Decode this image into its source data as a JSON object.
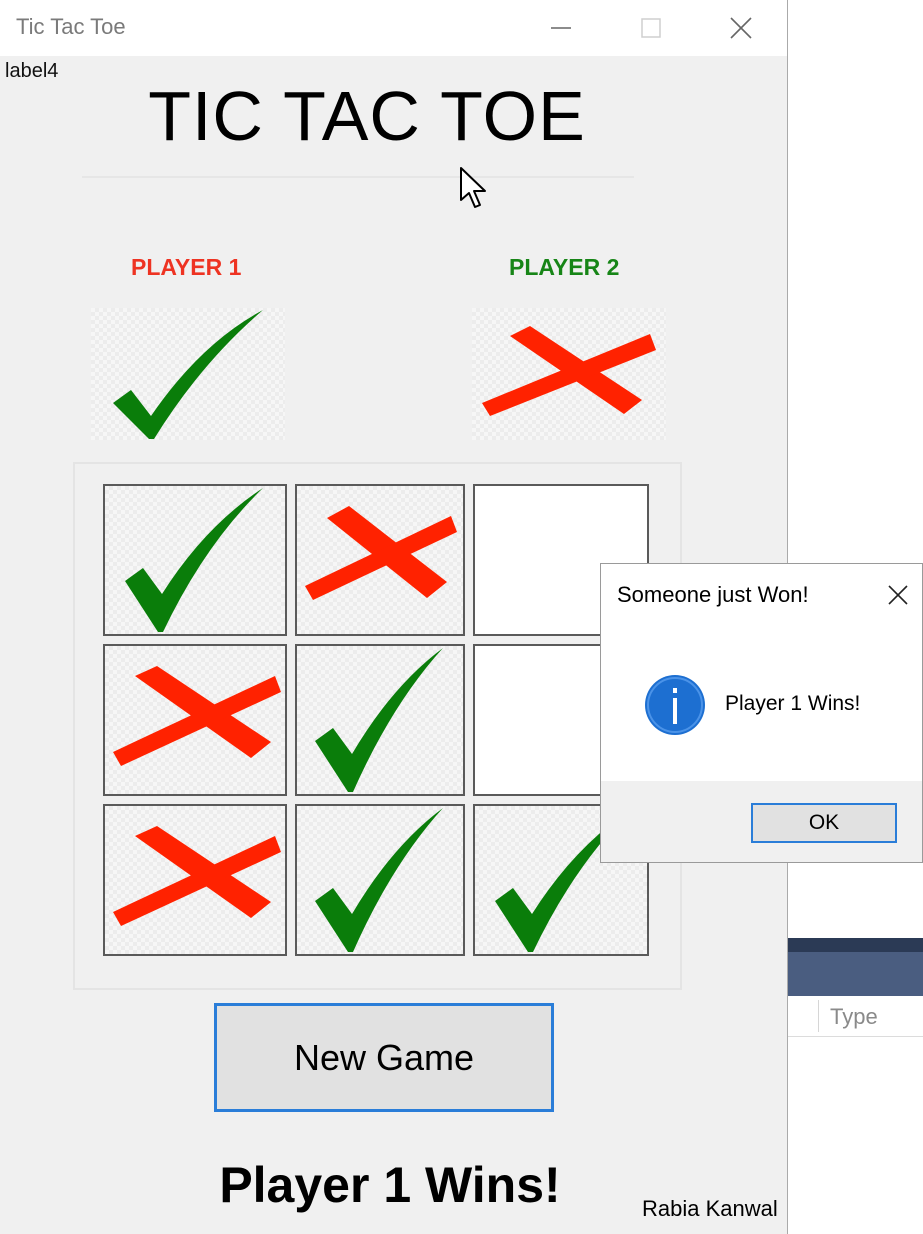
{
  "window": {
    "title": "Tic Tac Toe",
    "label_text": "label4",
    "game_title": "TIC TAC TOE",
    "caption_buttons": [
      "minimize-icon",
      "maximize-icon",
      "close-icon"
    ]
  },
  "players": {
    "p1_label": "PLAYER 1",
    "p1_color": "#ee3322",
    "p1_symbol": "check",
    "p2_label": "PLAYER 2",
    "p2_color": "#178517",
    "p2_symbol": "cross"
  },
  "board": {
    "cells": [
      [
        "check",
        "cross",
        "empty"
      ],
      [
        "cross",
        "check",
        "empty"
      ],
      [
        "cross",
        "check",
        "check"
      ]
    ]
  },
  "new_game_label": "New Game",
  "status_text": "Player 1 Wins!",
  "author": "Rabia Kanwal",
  "dialog": {
    "title": "Someone just Won!",
    "message": "Player 1 Wins!",
    "ok_label": "OK",
    "icon": "info-icon"
  },
  "background_app": {
    "column_header": "Type"
  },
  "colors": {
    "check": "#0a7d0a",
    "cross": "#ff2200",
    "accent": "#2a7dd8"
  }
}
